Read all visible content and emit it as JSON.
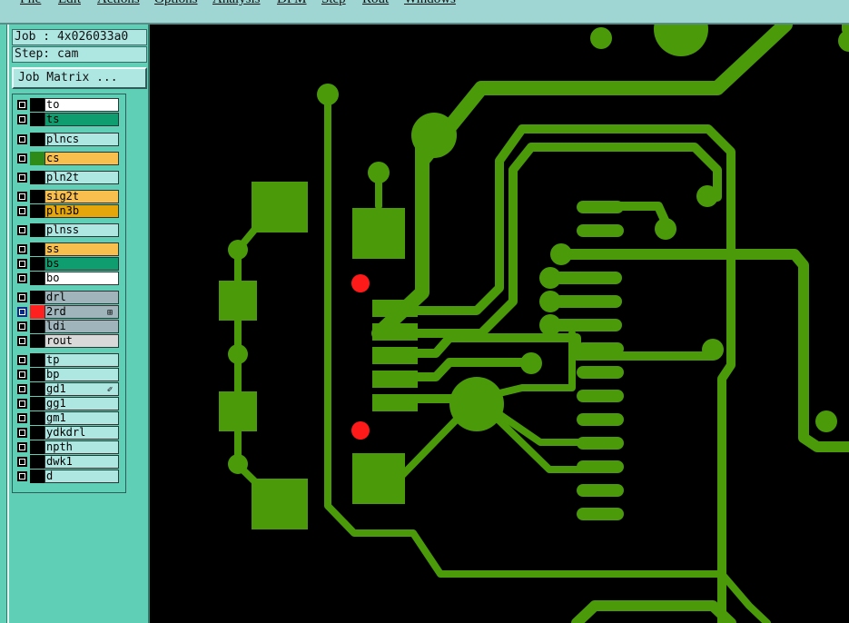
{
  "menu": [
    "File",
    "Edit",
    "Actions",
    "Options",
    "Analysis",
    "DFM",
    "Step",
    "Rout",
    "Windows"
  ],
  "job": {
    "label": "Job : 4x026033a0",
    "step": "Step: cam",
    "matrix_button": "Job Matrix ..."
  },
  "layers": [
    {
      "name": "to",
      "color": "#ffffff",
      "swatch": "#000000",
      "active": false,
      "mark": ""
    },
    {
      "name": "ts",
      "color": "#0f9c6e",
      "swatch": "#000000",
      "active": false,
      "mark": ""
    },
    {
      "name": "plncs",
      "color": "#aee6e2",
      "swatch": "#000000",
      "active": false,
      "mark": ""
    },
    {
      "name": "cs",
      "color": "#f8bf4e",
      "swatch": "#2e8b18",
      "active": false,
      "mark": ""
    },
    {
      "name": "pln2t",
      "color": "#aee6e2",
      "swatch": "#000000",
      "active": false,
      "mark": ""
    },
    {
      "name": "sig2t",
      "color": "#f8bf4e",
      "swatch": "#000000",
      "active": false,
      "mark": ""
    },
    {
      "name": "pln3b",
      "color": "#e5a60c",
      "swatch": "#000000",
      "active": false,
      "mark": ""
    },
    {
      "name": "plnss",
      "color": "#aee6e2",
      "swatch": "#000000",
      "active": false,
      "mark": ""
    },
    {
      "name": "ss",
      "color": "#f8bf4e",
      "swatch": "#000000",
      "active": false,
      "mark": ""
    },
    {
      "name": "bs",
      "color": "#0f9c6e",
      "swatch": "#000000",
      "active": false,
      "mark": ""
    },
    {
      "name": "bo",
      "color": "#ffffff",
      "swatch": "#000000",
      "active": false,
      "mark": ""
    },
    {
      "name": "drl",
      "color": "#9fb5bb",
      "swatch": "#000000",
      "active": false,
      "mark": ""
    },
    {
      "name": "2rd",
      "color": "#9fb5bb",
      "swatch": "#ff2020",
      "active": true,
      "mark": "⊞"
    },
    {
      "name": "ldi",
      "color": "#9fb5bb",
      "swatch": "#000000",
      "active": false,
      "mark": ""
    },
    {
      "name": "rout",
      "color": "#d9d9d9",
      "swatch": "#000000",
      "active": false,
      "mark": ""
    },
    {
      "name": "tp",
      "color": "#aee6e2",
      "swatch": "#000000",
      "active": false,
      "mark": ""
    },
    {
      "name": "bp",
      "color": "#aee6e2",
      "swatch": "#000000",
      "active": false,
      "mark": ""
    },
    {
      "name": "gd1",
      "color": "#aee6e2",
      "swatch": "#000000",
      "active": false,
      "mark": "✐"
    },
    {
      "name": "gg1",
      "color": "#aee6e2",
      "swatch": "#000000",
      "active": false,
      "mark": ""
    },
    {
      "name": "gm1",
      "color": "#aee6e2",
      "swatch": "#000000",
      "active": false,
      "mark": ""
    },
    {
      "name": "ydkdrl",
      "color": "#aee6e2",
      "swatch": "#000000",
      "active": false,
      "mark": ""
    },
    {
      "name": "npth",
      "color": "#aee6e2",
      "swatch": "#000000",
      "active": false,
      "mark": ""
    },
    {
      "name": "dwk1",
      "color": "#aee6e2",
      "swatch": "#000000",
      "active": false,
      "mark": ""
    },
    {
      "name": "d",
      "color": "#aee6e2",
      "swatch": "#000000",
      "active": false,
      "mark": ""
    }
  ],
  "colors": {
    "copper": "#4a9a0a",
    "drill": "#ff1a1a",
    "background": "#000000",
    "panel": "#5fd0b6",
    "menubar": "#9fd6d3"
  }
}
